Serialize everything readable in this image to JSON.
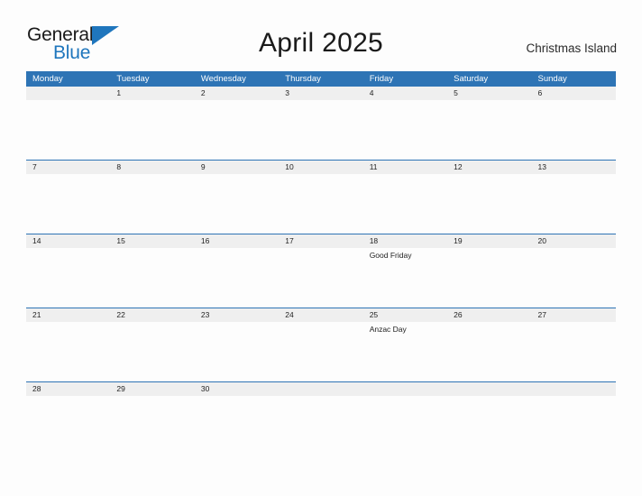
{
  "brand": {
    "word_one": "General",
    "word_two": "Blue",
    "flag_icon": "triangle-flag-icon",
    "accent_color": "#1f76bd"
  },
  "header": {
    "title": "April 2025",
    "location": "Christmas Island"
  },
  "calendar": {
    "header_bg": "#2e74b5",
    "date_strip_bg": "#efefef",
    "weekdays": [
      "Monday",
      "Tuesday",
      "Wednesday",
      "Thursday",
      "Friday",
      "Saturday",
      "Sunday"
    ],
    "weeks": [
      [
        {
          "date": "",
          "event": ""
        },
        {
          "date": "1",
          "event": ""
        },
        {
          "date": "2",
          "event": ""
        },
        {
          "date": "3",
          "event": ""
        },
        {
          "date": "4",
          "event": ""
        },
        {
          "date": "5",
          "event": ""
        },
        {
          "date": "6",
          "event": ""
        }
      ],
      [
        {
          "date": "7",
          "event": ""
        },
        {
          "date": "8",
          "event": ""
        },
        {
          "date": "9",
          "event": ""
        },
        {
          "date": "10",
          "event": ""
        },
        {
          "date": "11",
          "event": ""
        },
        {
          "date": "12",
          "event": ""
        },
        {
          "date": "13",
          "event": ""
        }
      ],
      [
        {
          "date": "14",
          "event": ""
        },
        {
          "date": "15",
          "event": ""
        },
        {
          "date": "16",
          "event": ""
        },
        {
          "date": "17",
          "event": ""
        },
        {
          "date": "18",
          "event": "Good Friday"
        },
        {
          "date": "19",
          "event": ""
        },
        {
          "date": "20",
          "event": ""
        }
      ],
      [
        {
          "date": "21",
          "event": ""
        },
        {
          "date": "22",
          "event": ""
        },
        {
          "date": "23",
          "event": ""
        },
        {
          "date": "24",
          "event": ""
        },
        {
          "date": "25",
          "event": "Anzac Day"
        },
        {
          "date": "26",
          "event": ""
        },
        {
          "date": "27",
          "event": ""
        }
      ],
      [
        {
          "date": "28",
          "event": ""
        },
        {
          "date": "29",
          "event": ""
        },
        {
          "date": "30",
          "event": ""
        },
        {
          "date": "",
          "event": ""
        },
        {
          "date": "",
          "event": ""
        },
        {
          "date": "",
          "event": ""
        },
        {
          "date": "",
          "event": ""
        }
      ]
    ]
  }
}
